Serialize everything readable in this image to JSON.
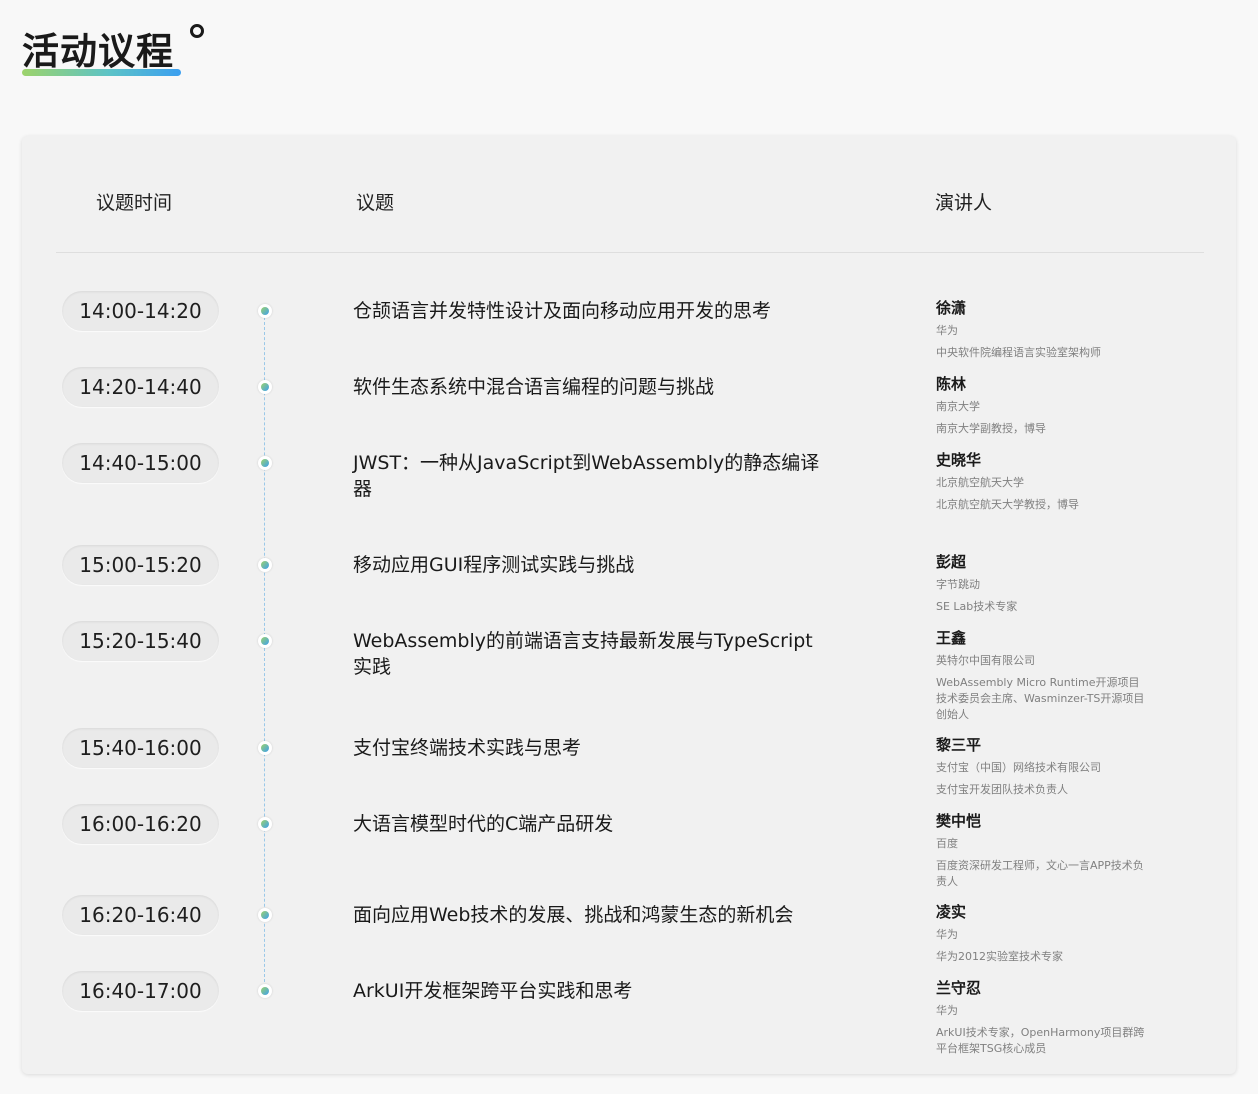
{
  "page": {
    "title": "活动议程"
  },
  "table": {
    "headers": {
      "time": "议题时间",
      "topic": "议题",
      "speaker": "演讲人"
    },
    "rows": [
      {
        "time": "14:00-14:20",
        "topic": "仓颉语言并发特性设计及面向移动应用开发的思考",
        "speaker": "徐潇",
        "org": "华为",
        "role": "中央软件院编程语言实验室架构师"
      },
      {
        "time": "14:20-14:40",
        "topic": "软件生态系统中混合语言编程的问题与挑战",
        "speaker": "陈林",
        "org": "南京大学",
        "role": "南京大学副教授，博导"
      },
      {
        "time": "14:40-15:00",
        "topic": "JWST：一种从JavaScript到WebAssembly的静态编译器",
        "speaker": "史晓华",
        "org": "北京航空航天大学",
        "role": "北京航空航天大学教授，博导"
      },
      {
        "time": "15:00-15:20",
        "topic": "移动应用GUI程序测试实践与挑战",
        "speaker": "彭超",
        "org": "字节跳动",
        "role": "SE Lab技术专家"
      },
      {
        "time": "15:20-15:40",
        "topic": "WebAssembly的前端语言支持最新发展与TypeScript实践",
        "speaker": "王鑫",
        "org": "英特尔中国有限公司",
        "role": "WebAssembly Micro Runtime开源项目技术委员会主席、Wasminzer-TS开源项目创始人"
      },
      {
        "time": "15:40-16:00",
        "topic": "支付宝终端技术实践与思考",
        "speaker": "黎三平",
        "org": "支付宝（中国）网络技术有限公司",
        "role": "支付宝开发团队技术负责人"
      },
      {
        "time": "16:00-16:20",
        "topic": "大语言模型时代的C端产品研发",
        "speaker": "樊中恺",
        "org": "百度",
        "role": "百度资深研发工程师，文心一言APP技术负责人"
      },
      {
        "time": "16:20-16:40",
        "topic": "面向应用Web技术的发展、挑战和鸿蒙生态的新机会",
        "speaker": "凌实",
        "org": "华为",
        "role": "华为2012实验室技术专家"
      },
      {
        "time": "16:40-17:00",
        "topic": "ArkUI开发框架跨平台实践和思考",
        "speaker": "兰守忍",
        "org": "华为",
        "role": "ArkUI技术专家，OpenHarmony项目群跨平台框架TSG核心成员"
      }
    ]
  }
}
